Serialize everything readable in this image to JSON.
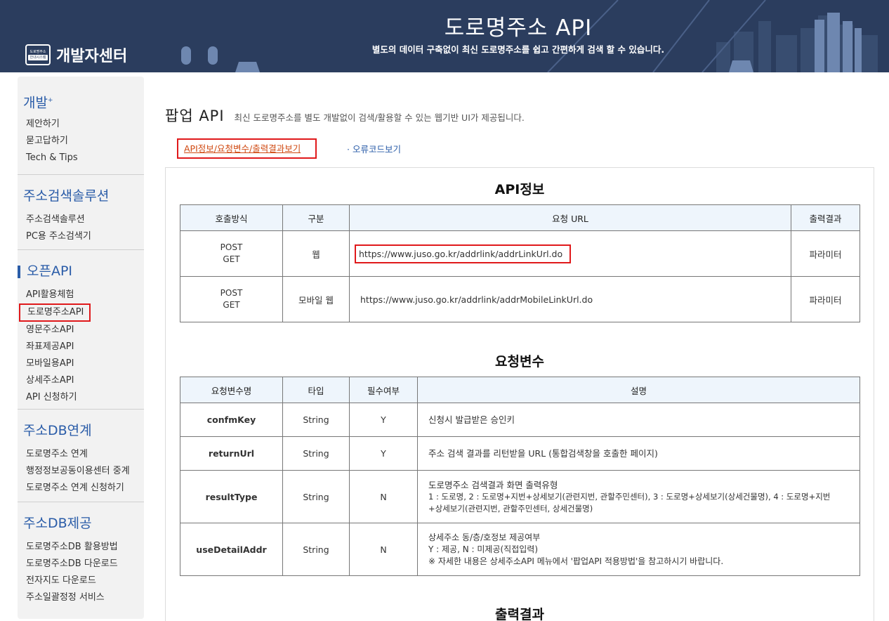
{
  "header": {
    "logo_badge_top": "도로명주소",
    "logo_badge_bottom": "안내시스템",
    "logo_text": "개발자센터",
    "title": "도로명주소 API",
    "subtitle": "별도의 데이터 구축없이 최신 도로명주소를 쉽고 간편하게 검색 할 수 있습니다."
  },
  "sidebar": {
    "groups": [
      {
        "title": "개발",
        "title_sup": "+",
        "items": [
          "제안하기",
          "묻고답하기",
          "Tech & Tips"
        ]
      },
      {
        "title": "주소검색솔루션",
        "items": [
          "주소검색솔루션",
          "PC용 주소검색기"
        ]
      },
      {
        "title": "오픈API",
        "items": [
          "API활용체험",
          "도로명주소API",
          "영문주소API",
          "좌표제공API",
          "모바일용API",
          "상세주소API",
          "API 신청하기"
        ]
      },
      {
        "title": "주소DB연계",
        "items": [
          "도로명주소 연계",
          "행정정보공동이용센터 중계",
          "도로명주소 연계 신청하기"
        ]
      },
      {
        "title": "주소DB제공",
        "items": [
          "도로명주소DB 활용방법",
          "도로명주소DB 다운로드",
          "전자지도 다운로드",
          "주소일괄정정 서비스"
        ]
      }
    ]
  },
  "main": {
    "title": "팝업 API",
    "description": "최신 도로명주소를 별도 개발없이 검색/활용할 수 있는 웹기반 UI가 제공됩니다.",
    "tabs": [
      "API정보/요청변수/출력결과보기",
      "오류코드보기"
    ]
  },
  "api_info": {
    "title": "API정보",
    "headers": [
      "호출방식",
      "구분",
      "요청 URL",
      "출력결과"
    ],
    "rows": [
      {
        "method1": "POST",
        "method2": "GET",
        "type": "웹",
        "url": "https://www.juso.go.kr/addrlink/addrLinkUrl.do",
        "output": "파라미터"
      },
      {
        "method1": "POST",
        "method2": "GET",
        "type": "모바일 웹",
        "url": "https://www.juso.go.kr/addrlink/addrMobileLinkUrl.do",
        "output": "파라미터"
      }
    ]
  },
  "request_params": {
    "title": "요청변수",
    "headers": [
      "요청변수명",
      "타입",
      "필수여부",
      "설명"
    ],
    "rows": [
      {
        "name": "confmKey",
        "type": "String",
        "required": "Y",
        "desc": [
          "신청시 발급받은 승인키"
        ]
      },
      {
        "name": "returnUrl",
        "type": "String",
        "required": "Y",
        "desc": [
          "주소 검색 결과를 리턴받을 URL (통합검색창을 호출한 페이지)"
        ]
      },
      {
        "name": "resultType",
        "type": "String",
        "required": "N",
        "desc": [
          "도로명주소 검색결과 화면 출력유형",
          "1 : 도로명, 2 : 도로명+지번+상세보기(관련지번, 관할주민센터), 3 : 도로명+상세보기(상세건물명), 4 : 도로명+지번",
          "+상세보기(관련지번, 관할주민센터, 상세건물명)"
        ]
      },
      {
        "name": "useDetailAddr",
        "type": "String",
        "required": "N",
        "desc": [
          "상세주소 동/층/호정보 제공여부",
          "Y : 제공, N : 미제공(직접입력)",
          "※ 자세한 내용은 상세주소API 메뉴에서 '팝업API 적용방법'을 참고하시기 바랍니다."
        ]
      }
    ]
  },
  "output_section": {
    "title": "출력결과"
  }
}
